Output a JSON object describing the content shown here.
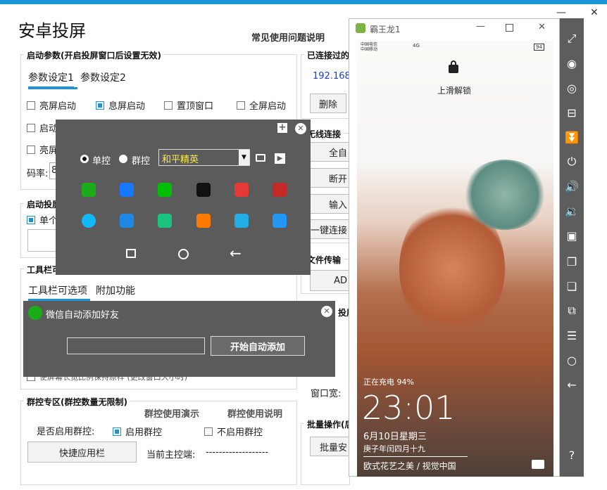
{
  "app": {
    "title": "安卓投屏",
    "faq": "常见使用问题说明"
  },
  "params": {
    "group_title": "启动参数(开启投屏窗口后设置无效)",
    "tabs": [
      "参数设定1",
      "参数设定2"
    ],
    "checks": [
      {
        "label": "亮屏启动",
        "checked": false
      },
      {
        "label": "息屏启动",
        "checked": true
      },
      {
        "label": "置顶窗口",
        "checked": false
      },
      {
        "label": "全屏启动",
        "checked": false
      }
    ],
    "row2_label": "启动",
    "row3_label": "亮屏",
    "bitrate_label": "码率:",
    "bitrate_value": "8"
  },
  "launch": {
    "title": "启动投屏",
    "single_label": "单个"
  },
  "toolbar_group": {
    "title": "工具栏可",
    "tabs": [
      "工具栏可选项",
      "附加功能"
    ],
    "hidden_text": "使屏幕长宽比例保持原样 (更改窗口大小时)"
  },
  "connected": {
    "title": "已连接过的",
    "ip": "192.168.1",
    "delete_label": "删除"
  },
  "wireless": {
    "title": "无线连接",
    "btn_all": "全自",
    "btn_disconnect": "断开",
    "btn_input": "输入",
    "btn_onekey": "一键连接"
  },
  "file_transfer": {
    "title": "文件传输",
    "btn_add": "AD"
  },
  "screen_group": {
    "title": "投屏",
    "window_width_label": "窗口宽:"
  },
  "batch": {
    "title": "批量操作(后",
    "btn": "批量安"
  },
  "group_ctrl": {
    "title": "群控专区(群控数量无限制)",
    "demo": "群控使用演示",
    "help": "群控使用说明",
    "enable_label": "是否启用群控:",
    "enable_on": "启用群控",
    "enable_off": "不启用群控",
    "quick_bar": "快捷应用栏",
    "master_label": "当前主控端:",
    "master_value": "-------------------"
  },
  "mini_panel": {
    "radio_single": "单控",
    "radio_group": "群控",
    "game_select": "和平精英",
    "apps_row1": [
      {
        "name": "wechat-icon",
        "color": "#1aad19"
      },
      {
        "name": "alipay-icon",
        "color": "#1677ff"
      },
      {
        "name": "iqiyi-icon",
        "color": "#00be06"
      },
      {
        "name": "tiktok-icon",
        "color": "#111111"
      },
      {
        "name": "netease-icon",
        "color": "#e53935"
      },
      {
        "name": "game-icon",
        "color": "#c62828"
      }
    ],
    "apps_row2": [
      {
        "name": "qq-icon",
        "color": "#12b7f5"
      },
      {
        "name": "app-store-icon",
        "color": "#1e88e5"
      },
      {
        "name": "tencent-video-icon",
        "color": "#19c37d"
      },
      {
        "name": "kuaishou-icon",
        "color": "#ff7a00"
      },
      {
        "name": "bilibili-icon",
        "color": "#23ade5"
      },
      {
        "name": "camera-icon",
        "color": "#2196f3"
      }
    ]
  },
  "wechat_panel": {
    "title": "微信自动添加好友",
    "input_value": "",
    "start_btn": "开始自动添加"
  },
  "phone": {
    "window_title": "霸王龙1",
    "carrier1": "中国电信",
    "carrier2": "中国移动",
    "signal": "5G",
    "net_speed": "4G",
    "unlock": "上滑解锁",
    "charging": "正在充电 94%",
    "time": "23:01",
    "date": "6月10日星期三",
    "lunar": "庚子年闰四月十九",
    "caption": "欧式花艺之美 / 视觉中国",
    "battery": "94"
  },
  "colors": {
    "accent": "#1b95d8",
    "dark_panel": "#5b5b5b",
    "side_bar": "#5d5d5d"
  }
}
